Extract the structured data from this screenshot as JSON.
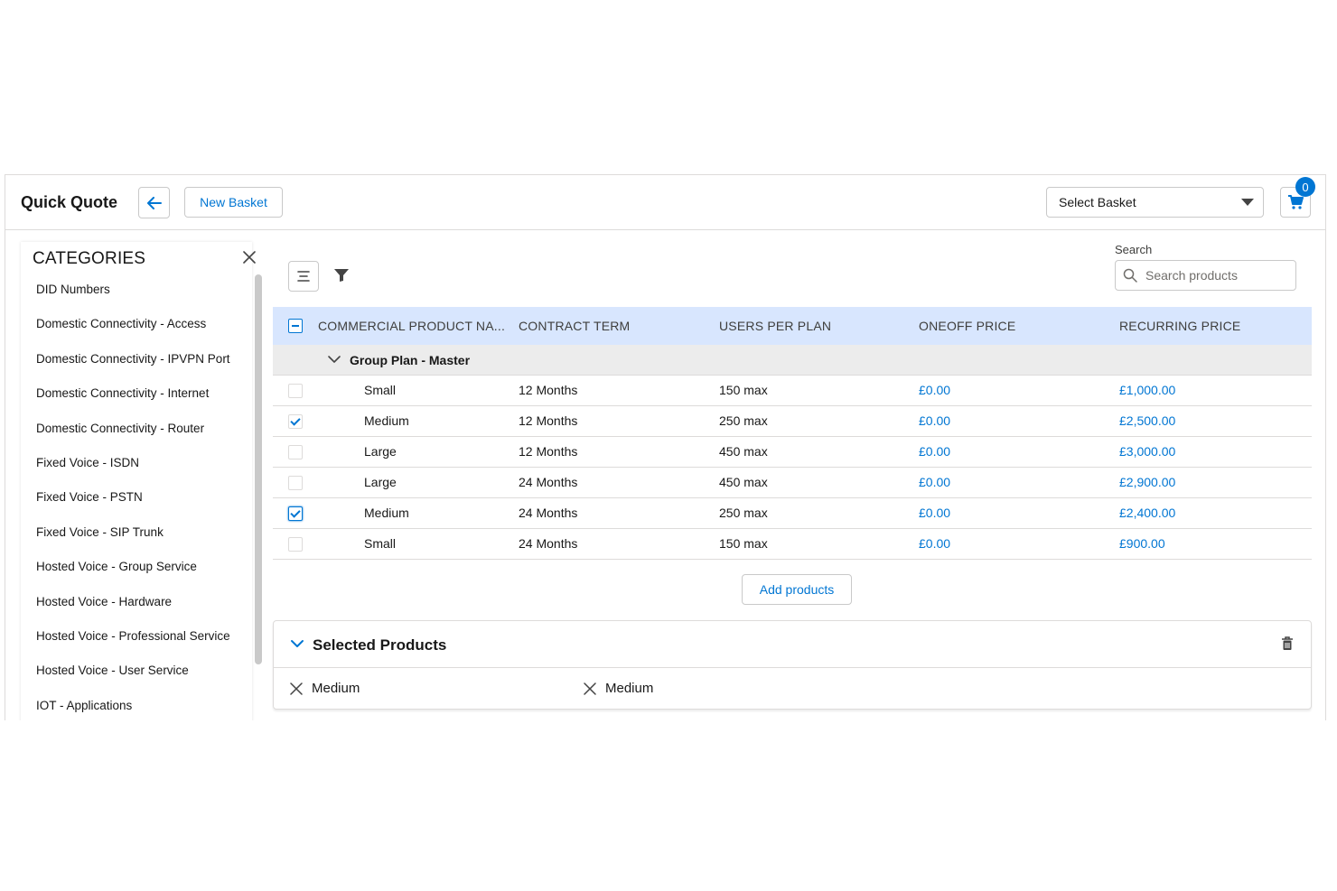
{
  "header": {
    "title": "Quick Quote",
    "new_basket_label": "New Basket",
    "select_basket_label": "Select Basket",
    "cart_count": "0"
  },
  "sidebar": {
    "title": "CATEGORIES",
    "items": [
      "DID Numbers",
      "Domestic Connectivity - Access",
      "Domestic Connectivity - IPVPN Port",
      "Domestic Connectivity - Internet",
      "Domestic Connectivity - Router",
      "Fixed Voice - ISDN",
      "Fixed Voice - PSTN",
      "Fixed Voice - SIP Trunk",
      "Hosted Voice - Group Service",
      "Hosted Voice - Hardware",
      "Hosted Voice - Professional Service",
      "Hosted Voice - User Service",
      "IOT - Applications"
    ]
  },
  "search": {
    "label": "Search",
    "placeholder": "Search products"
  },
  "table": {
    "columns": [
      "COMMERCIAL PRODUCT NA...",
      "CONTRACT TERM",
      "USERS PER PLAN",
      "ONEOFF PRICE",
      "RECURRING PRICE"
    ],
    "group": "Group Plan - Master",
    "rows": [
      {
        "name": "Small",
        "term": "12 Months",
        "users": "150 max",
        "oneoff": "£0.00",
        "recurring": "£1,000.00",
        "checked": false
      },
      {
        "name": "Medium",
        "term": "12 Months",
        "users": "250 max",
        "oneoff": "£0.00",
        "recurring": "£2,500.00",
        "checked": true
      },
      {
        "name": "Large",
        "term": "12 Months",
        "users": "450 max",
        "oneoff": "£0.00",
        "recurring": "£3,000.00",
        "checked": false
      },
      {
        "name": "Large",
        "term": "24 Months",
        "users": "450 max",
        "oneoff": "£0.00",
        "recurring": "£2,900.00",
        "checked": false
      },
      {
        "name": "Medium",
        "term": "24 Months",
        "users": "250 max",
        "oneoff": "£0.00",
        "recurring": "£2,400.00",
        "checked": true
      },
      {
        "name": "Small",
        "term": "24 Months",
        "users": "150 max",
        "oneoff": "£0.00",
        "recurring": "£900.00",
        "checked": false
      }
    ]
  },
  "add_products_label": "Add products",
  "selected_products": {
    "title": "Selected Products",
    "items": [
      "Medium",
      "Medium"
    ]
  },
  "colors": {
    "brand": "#0176d3",
    "header_row": "#d8e6fe",
    "group_row": "#ececec"
  }
}
